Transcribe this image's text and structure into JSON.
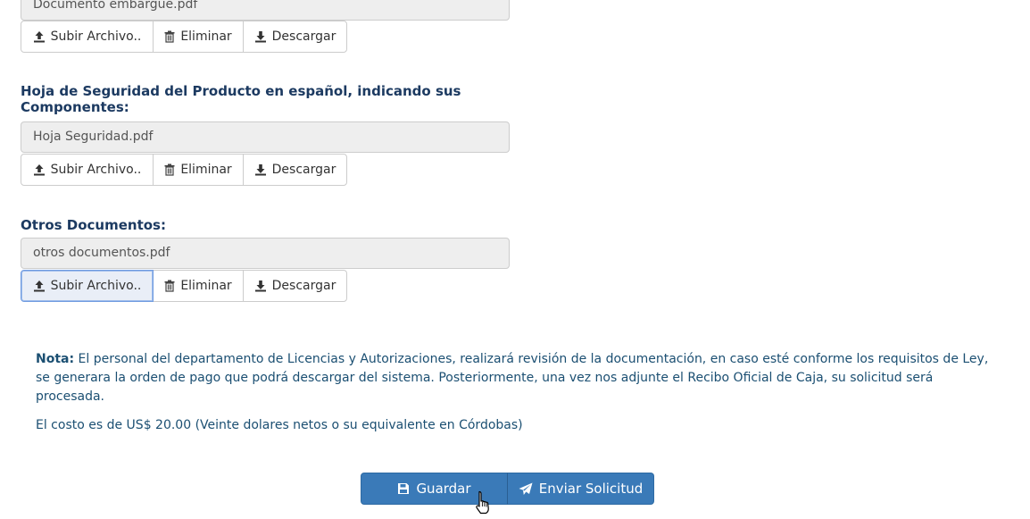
{
  "documents": [
    {
      "label": "",
      "file": "Documento embargue.pdf"
    },
    {
      "label": "Hoja de Seguridad del Producto en español, indicando sus Componentes:",
      "file": "Hoja Seguridad.pdf"
    },
    {
      "label": "Otros Documentos:",
      "file": "otros documentos.pdf"
    }
  ],
  "buttons": {
    "upload": "Subir Archivo..",
    "delete": "Eliminar",
    "download": "Descargar"
  },
  "note": {
    "prefix": "Nota:",
    "text": " El personal del departamento de Licencias y Autorizaciones, realizará revisión de la documentación, en caso esté conforme los requisitos de Ley, se generara la orden de pago que podrá descargar del sistema. Posteriormente, una vez nos adjunte el Recibo Oficial de Caja, su solicitud será procesada.",
    "cost": "El costo es de US$ 20.00 (Veinte dolares netos o su equivalente en Córdobas)"
  },
  "actions": {
    "save": "Guardar",
    "send": "Enviar Solicitud"
  },
  "colors": {
    "label": "#1c3a61",
    "note": "#1b4f72",
    "primary": "#3a7ab8"
  },
  "icons": {
    "upload": "upload-icon",
    "delete": "trash-icon",
    "download": "download-icon",
    "save": "floppy-disk-icon",
    "send": "paper-plane-icon"
  }
}
